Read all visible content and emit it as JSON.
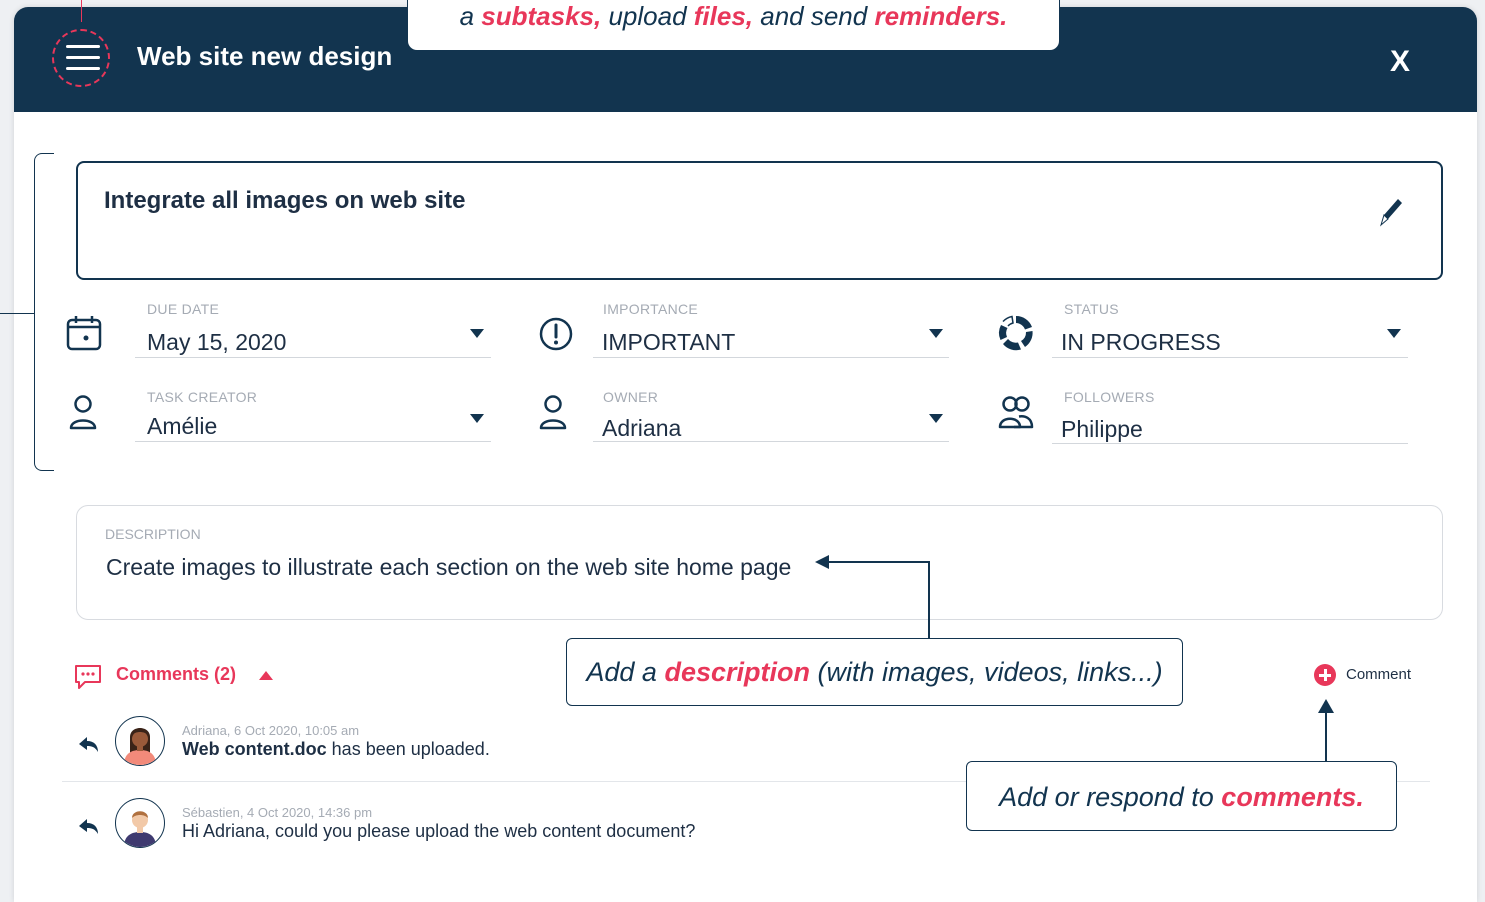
{
  "header": {
    "title": "Web site new design",
    "close_label": "X"
  },
  "callouts": {
    "top": {
      "part1": "a ",
      "subtasks": "subtasks,",
      "part2": " upload ",
      "files": "files,",
      "part3": " and send ",
      "reminders": "reminders."
    },
    "description": {
      "part1": "Add a ",
      "highlight": "description",
      "part2": " (with images, videos, links...)"
    },
    "comments": {
      "part1": "Add or respond to ",
      "highlight": "comments."
    }
  },
  "task": {
    "title": "Integrate all images on web site"
  },
  "fields": {
    "due_date": {
      "label": "DUE DATE",
      "value": "May 15, 2020"
    },
    "importance": {
      "label": "IMPORTANCE",
      "value": "IMPORTANT"
    },
    "status": {
      "label": "STATUS",
      "value": "IN PROGRESS"
    },
    "task_creator": {
      "label": "TASK CREATOR",
      "value": "Amélie"
    },
    "owner": {
      "label": "OWNER",
      "value": "Adriana"
    },
    "followers": {
      "label": "FOLLOWERS",
      "value": "Philippe"
    }
  },
  "description": {
    "label": "DESCRIPTION",
    "text": "Create images to illustrate each section on the web site home page"
  },
  "comments": {
    "header": "Comments (2)",
    "add_label": "Comment",
    "items": [
      {
        "meta": "Adriana, 6 Oct 2020, 10:05 am",
        "bold": "Web content.doc",
        "text": " has been uploaded."
      },
      {
        "meta": "Sébastien, 4 Oct 2020, 14:36 pm",
        "bold": "",
        "text": "Hi Adriana, could you please upload the web content document?"
      }
    ]
  },
  "colors": {
    "navy": "#12344f",
    "accent": "#e8375a",
    "muted": "#a5abb4"
  }
}
